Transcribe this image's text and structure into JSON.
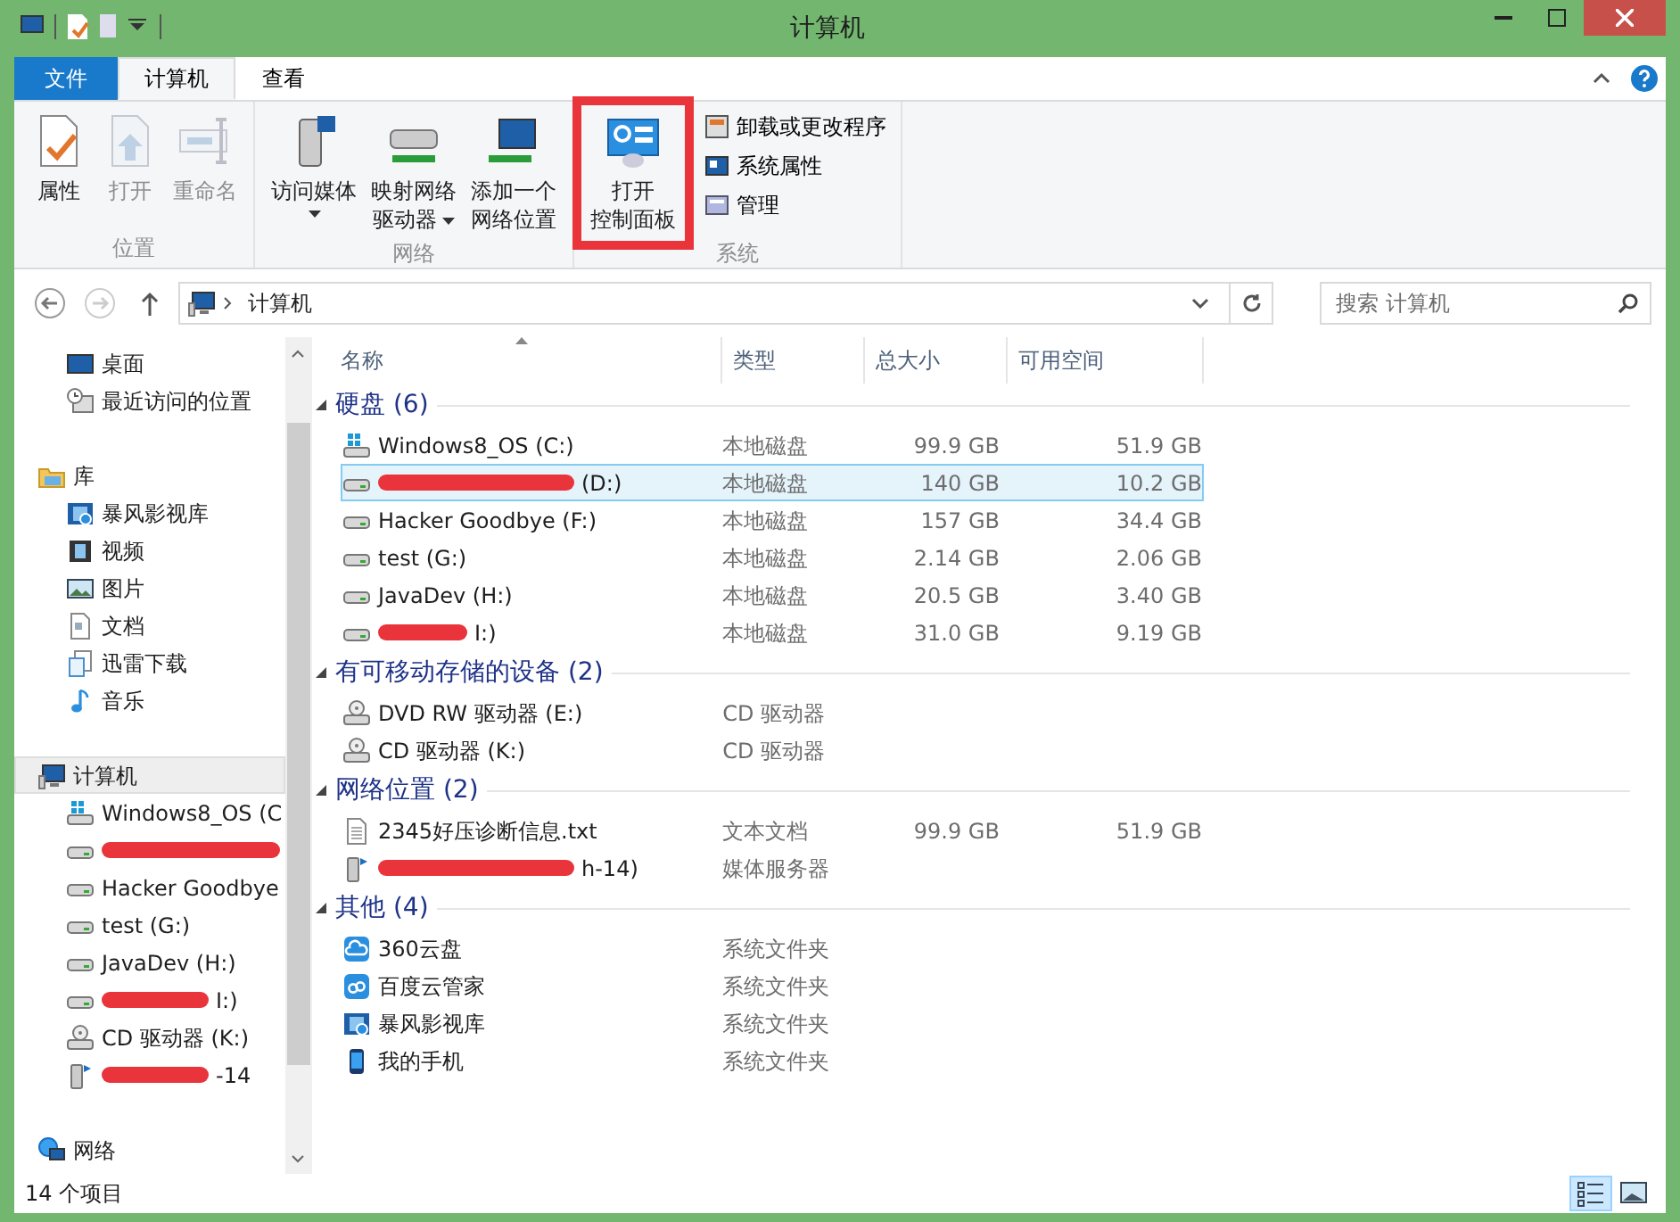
{
  "window": {
    "title": "计算机"
  },
  "ribbon_tabs": [
    {
      "label": "文件",
      "kind": "file",
      "selected": false
    },
    {
      "label": "计算机",
      "kind": "tab",
      "selected": true
    },
    {
      "label": "查看",
      "kind": "tab",
      "selected": false
    }
  ],
  "ribbon_groups": [
    {
      "title": "位置",
      "buttons": [
        {
          "lines": [
            "属性"
          ],
          "kind": "properties",
          "disabled": false,
          "dropdown": false
        },
        {
          "lines": [
            "打开"
          ],
          "kind": "open",
          "disabled": true,
          "dropdown": false
        },
        {
          "lines": [
            "重命名"
          ],
          "kind": "rename",
          "disabled": true,
          "dropdown": false
        }
      ]
    },
    {
      "title": "网络",
      "buttons": [
        {
          "lines": [
            "访问媒体"
          ],
          "kind": "media",
          "disabled": false,
          "dropdown": true
        },
        {
          "lines": [
            "映射网络",
            "驱动器"
          ],
          "kind": "map-drive",
          "disabled": false,
          "dropdown": true
        },
        {
          "lines": [
            "添加一个",
            "网络位置"
          ],
          "kind": "add-location",
          "disabled": false,
          "dropdown": false
        }
      ]
    },
    {
      "title": "系统",
      "buttons": [
        {
          "lines": [
            "打开",
            "控制面板"
          ],
          "kind": "control-panel",
          "disabled": false,
          "dropdown": false,
          "highlighted": true
        }
      ],
      "small_buttons": [
        {
          "label": "卸载或更改程序",
          "kind": "uninstall"
        },
        {
          "label": "系统属性",
          "kind": "sysprops"
        },
        {
          "label": "管理",
          "kind": "manage"
        }
      ]
    }
  ],
  "address": {
    "path": "计算机",
    "back_disabled": false,
    "forward_disabled": true
  },
  "search": {
    "placeholder": "搜索 计算机"
  },
  "nav": [
    {
      "children": [
        {
          "label": "桌面",
          "kind": "desktop"
        },
        {
          "label": "最近访问的位置",
          "kind": "recent"
        }
      ]
    },
    {
      "label": "库",
      "kind": "library",
      "selected": false,
      "children": [
        {
          "label": "暴风影视库",
          "kind": "film"
        },
        {
          "label": "视频",
          "kind": "video"
        },
        {
          "label": "图片",
          "kind": "picture"
        },
        {
          "label": "文档",
          "kind": "doc"
        },
        {
          "label": "迅雷下载",
          "kind": "download"
        },
        {
          "label": "音乐",
          "kind": "music"
        }
      ]
    },
    {
      "label": "计算机",
      "kind": "computer",
      "selected": true,
      "children": [
        {
          "label": "Windows8_OS (C",
          "kind": "windrive"
        },
        {
          "kind": "drive",
          "redacted": true
        },
        {
          "label": "Hacker Goodbye",
          "kind": "drive"
        },
        {
          "label": "test (G:)",
          "kind": "drive"
        },
        {
          "label": "JavaDev (H:)",
          "kind": "drive"
        },
        {
          "label": "I:)",
          "kind": "drive",
          "redacted": true
        },
        {
          "label": "CD 驱动器 (K:)",
          "kind": "cd"
        },
        {
          "label": "-14",
          "kind": "media-server",
          "redacted": true
        }
      ]
    },
    {
      "label": "网络",
      "kind": "network",
      "selected": false
    }
  ],
  "columns": [
    "名称",
    "类型",
    "总大小",
    "可用空间"
  ],
  "groups": [
    {
      "title": "硬盘 (6)",
      "expanded": true,
      "items": [
        {
          "name": "Windows8_OS (C:)",
          "kind": "windrive",
          "type": "本地磁盘",
          "total": "99.9 GB",
          "free": "51.9 GB",
          "selected": false
        },
        {
          "name": "(D:)",
          "kind": "drive",
          "redacted": true,
          "type": "本地磁盘",
          "total": "140 GB",
          "free": "10.2 GB",
          "selected": true
        },
        {
          "name": "Hacker Goodbye (F:)",
          "kind": "drive",
          "type": "本地磁盘",
          "total": "157 GB",
          "free": "34.4 GB",
          "selected": false
        },
        {
          "name": "test (G:)",
          "kind": "drive",
          "type": "本地磁盘",
          "total": "2.14 GB",
          "free": "2.06 GB",
          "selected": false
        },
        {
          "name": "JavaDev (H:)",
          "kind": "drive",
          "type": "本地磁盘",
          "total": "20.5 GB",
          "free": "3.40 GB",
          "selected": false
        },
        {
          "name": "I:)",
          "kind": "drive",
          "redacted": true,
          "type": "本地磁盘",
          "total": "31.0 GB",
          "free": "9.19 GB",
          "selected": false
        }
      ]
    },
    {
      "title": "有可移动存储的设备 (2)",
      "expanded": true,
      "items": [
        {
          "name": "DVD RW 驱动器 (E:)",
          "kind": "cd",
          "type": "CD 驱动器",
          "selected": false
        },
        {
          "name": "CD 驱动器 (K:)",
          "kind": "cd",
          "type": "CD 驱动器",
          "selected": false
        }
      ]
    },
    {
      "title": "网络位置 (2)",
      "expanded": true,
      "items": [
        {
          "name": "2345好压诊断信息.txt",
          "kind": "txt",
          "type": "文本文档",
          "total": "99.9 GB",
          "free": "51.9 GB",
          "selected": false
        },
        {
          "name": "h-14)",
          "kind": "media-server",
          "redacted": true,
          "type": "媒体服务器",
          "selected": false
        }
      ]
    },
    {
      "title": "其他 (4)",
      "expanded": true,
      "items": [
        {
          "name": "360云盘",
          "kind": "cloud",
          "type": "系统文件夹",
          "selected": false
        },
        {
          "name": "百度云管家",
          "kind": "cloud2",
          "type": "系统文件夹",
          "selected": false
        },
        {
          "name": "暴风影视库",
          "kind": "film",
          "type": "系统文件夹",
          "selected": false
        },
        {
          "name": "我的手机",
          "kind": "phone",
          "type": "系统文件夹",
          "selected": false
        }
      ]
    }
  ],
  "status": {
    "count": "14 个项目",
    "views": [
      {
        "kind": "details",
        "selected": true
      },
      {
        "kind": "large-icons",
        "selected": false
      }
    ]
  }
}
